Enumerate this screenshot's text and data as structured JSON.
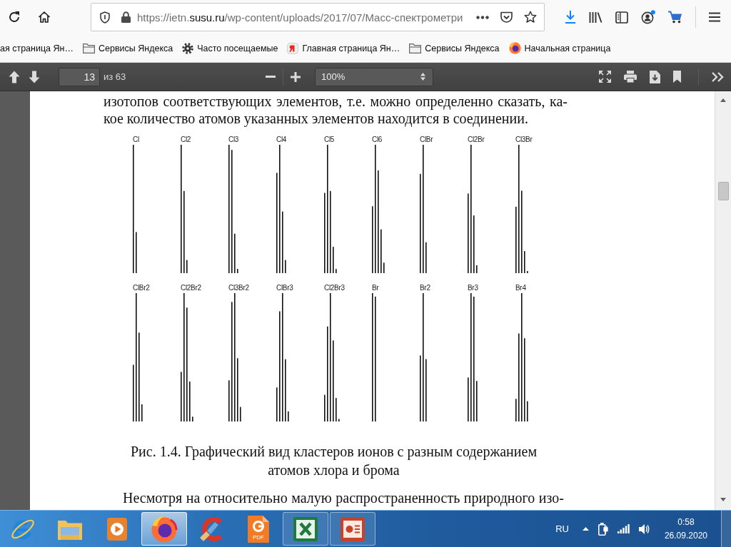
{
  "address_bar": {
    "prefix": "https://ietn.",
    "domain": "susu.ru",
    "path": "/wp-content/uploads/2017/07/Масс-спектрометри"
  },
  "bookmarks": [
    {
      "kind": "plain",
      "label": "ая страница Ян…"
    },
    {
      "kind": "folder",
      "label": "Сервисы Яндекса"
    },
    {
      "kind": "gear",
      "label": "Часто посещаемые"
    },
    {
      "kind": "site",
      "label": "Главная страница Ян…"
    },
    {
      "kind": "folder",
      "label": "Сервисы Яндекса"
    },
    {
      "kind": "browser",
      "label": "Начальная страница"
    }
  ],
  "pdf_toolbar": {
    "page_number": "13",
    "page_count": "из 63",
    "zoom": "100%"
  },
  "document": {
    "blocks": [
      {
        "kind": "paragraph_tail",
        "lines": [
          "изотопов соответствующих элементов, т.е. можно определенно сказать, ка-",
          "кое количество атомов указанных элементов находится в соединении."
        ]
      },
      {
        "kind": "figure",
        "rows": [
          [
            "Cl",
            "Cl2",
            "Cl3",
            "Cl4",
            "Cl5",
            "Cl6",
            "ClBr",
            "Cl2Br",
            "Cl3Br"
          ],
          [
            "ClBr2",
            "Cl2Br2",
            "Cl3Br2",
            "ClBr3",
            "Cl2Br3",
            "Br",
            "Br2",
            "Br3",
            "Br4"
          ]
        ]
      },
      {
        "kind": "caption",
        "lines": [
          "Рис. 1.4. Графический вид кластеров ионов с разным содержанием",
          "атомов хлора и брома"
        ]
      },
      {
        "kind": "paragraph_head",
        "lines": [
          "Несмотря на относительно малую распространенность природного изо-"
        ]
      }
    ]
  },
  "taskbar": {
    "apps": [
      {
        "kind": "ie",
        "selected": false,
        "running": false
      },
      {
        "kind": "explorer",
        "selected": false,
        "running": false
      },
      {
        "kind": "media",
        "selected": false,
        "running": false
      },
      {
        "kind": "firefox",
        "selected": true,
        "running": true
      },
      {
        "kind": "cleaner",
        "selected": false,
        "running": false
      },
      {
        "kind": "pdf",
        "label": "PDF",
        "selected": false,
        "running": false
      },
      {
        "kind": "excel",
        "selected": false,
        "running": true
      },
      {
        "kind": "powerpoint",
        "selected": false,
        "running": true
      }
    ],
    "language": "RU",
    "time": "0:58",
    "date": "26.09.2020"
  }
}
